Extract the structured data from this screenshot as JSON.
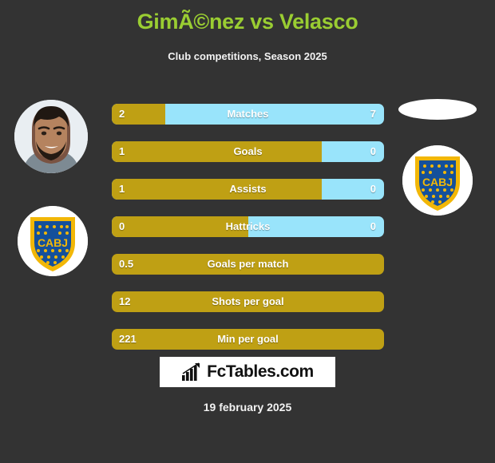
{
  "header": {
    "title": "GimÃ©nez vs Velasco",
    "subtitle": "Club competitions, Season 2025"
  },
  "media": {
    "player_left_photo": "player-photo",
    "badge_left": "cabj-club-badge",
    "badge_left_text": "CABJ",
    "badge_right": "cabj-club-badge",
    "badge_right_text": "CABJ",
    "player_right_photo": "player-photo-cropped"
  },
  "stats": [
    {
      "label": "Matches",
      "left": "2",
      "right": "7",
      "left_pct": 19.6,
      "split": true
    },
    {
      "label": "Goals",
      "left": "1",
      "right": "0",
      "left_pct": 77.0,
      "split": true
    },
    {
      "label": "Assists",
      "left": "1",
      "right": "0",
      "left_pct": 77.0,
      "split": true
    },
    {
      "label": "Hattricks",
      "left": "0",
      "right": "0",
      "left_pct": 50.0,
      "split": true
    },
    {
      "label": "Goals per match",
      "left": "0.5",
      "right": "",
      "left_pct": 100.0,
      "split": false
    },
    {
      "label": "Shots per goal",
      "left": "12",
      "right": "",
      "left_pct": 100.0,
      "split": false
    },
    {
      "label": "Min per goal",
      "left": "221",
      "right": "",
      "left_pct": 100.0,
      "split": false
    }
  ],
  "footer": {
    "logo_text": "FcTables.com",
    "logo_icon": "bar-chart-arrow-icon",
    "date": "19 february 2025"
  },
  "colors": {
    "background": "#333333",
    "title": "#9ACD32",
    "bar_primary": "#BFA014",
    "bar_secondary": "#99E4FB",
    "text": "#ffffff",
    "badge_blue": "#14509B",
    "badge_gold": "#F2B707"
  }
}
